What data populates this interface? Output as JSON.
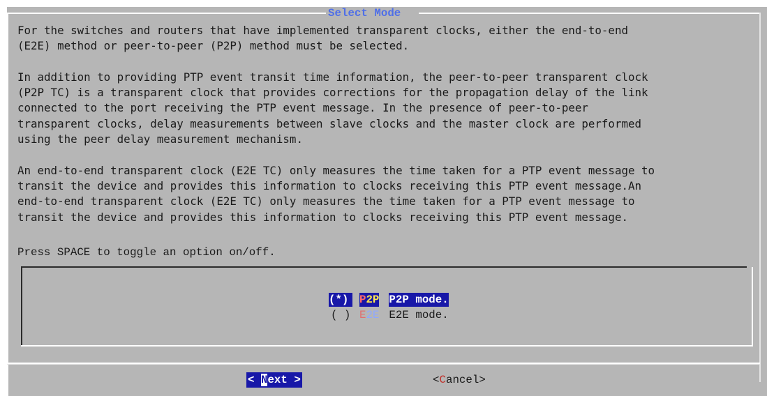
{
  "dialog": {
    "title": "Select Mode",
    "description": "For the switches and routers that have implemented transparent clocks, either the end-to-end\n(E2E) method or peer-to-peer (P2P) method must be selected.\n\nIn addition to providing PTP event transit time information, the peer-to-peer transparent clock\n(P2P TC) is a transparent clock that provides corrections for the propagation delay of the link\nconnected to the port receiving the PTP event message. In the presence of peer-to-peer\ntransparent clocks, delay measurements between slave clocks and the master clock are performed\nusing the peer delay measurement mechanism.\n\nAn end-to-end transparent clock (E2E TC) only measures the time taken for a PTP event message to\ntransit the device and provides this information to clocks receiving this PTP event message.An\nend-to-end transparent clock (E2E TC) only measures the time taken for a PTP event message to\ntransit the device and provides this information to clocks receiving this PTP event message.",
    "hint": "Press SPACE to toggle an option on/off."
  },
  "options": [
    {
      "mark": "(*)",
      "tag_first": "P",
      "tag_rest": "2P",
      "label": "P2P mode.",
      "selected": true
    },
    {
      "mark": "( )",
      "tag_first": "E",
      "tag_rest": "2E",
      "label": "E2E mode.",
      "selected": false
    }
  ],
  "buttons": {
    "next": {
      "left": "< ",
      "hot": "N",
      "rest": "ext >"
    },
    "cancel": {
      "left": "<",
      "hot": "C",
      "rest": "ancel>"
    }
  },
  "colors": {
    "background": "#b6b6b6",
    "title": "#4f6fe8",
    "selection": "#1818a8",
    "hotkey_red": "#c0312b"
  }
}
